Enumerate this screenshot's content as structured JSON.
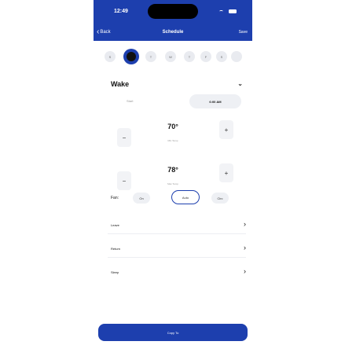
{
  "status_bar": {
    "time": "12:49"
  },
  "nav": {
    "back_label": "Back",
    "title": "Schedule",
    "save_label": "Save"
  },
  "days": [
    {
      "label": "S",
      "selected": false
    },
    {
      "label": "",
      "selected": true
    },
    {
      "label": "T",
      "selected": false
    },
    {
      "label": "W",
      "selected": false
    },
    {
      "label": "T",
      "selected": false
    },
    {
      "label": "F",
      "selected": false
    },
    {
      "label": "S",
      "selected": false
    },
    {
      "label": "",
      "selected": false
    }
  ],
  "wake": {
    "title": "Wake",
    "start_label": "Start",
    "start_value": "6:00 AM",
    "min_temp": {
      "value": "70°",
      "label": "Min Temp",
      "minus": "−",
      "plus": "+"
    },
    "max_temp": {
      "value": "78°",
      "label": "Max Temp",
      "minus": "−",
      "plus": "+"
    },
    "fan": {
      "label": "Fan:",
      "options": [
        "On",
        "Auto",
        "Circ"
      ],
      "selected": "Auto"
    }
  },
  "periods": [
    {
      "label": "Leave"
    },
    {
      "label": "Return"
    },
    {
      "label": "Sleep"
    }
  ],
  "copy_button": "Copy To",
  "colors": {
    "primary": "#1d3fae",
    "secondary_bg": "#eef0f4"
  }
}
